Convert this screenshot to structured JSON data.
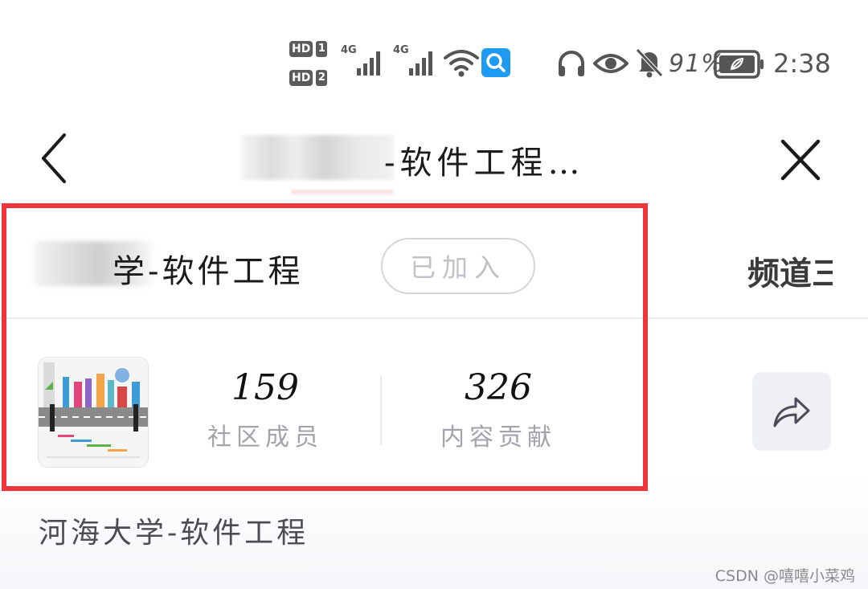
{
  "status_bar": {
    "sim1_label": "HD",
    "sim1_number": "1",
    "sim2_label": "HD",
    "sim2_number": "2",
    "network1": "4G",
    "network2": "4G",
    "battery_percent": "91%",
    "time": "2:38"
  },
  "title_bar": {
    "title": "-软件工程…"
  },
  "community": {
    "name": "学-软件工程",
    "joined_label": "已加入",
    "channel_label": "频道三",
    "stats": [
      {
        "value": "159",
        "label": "社区成员"
      },
      {
        "value": "326",
        "label": "内容贡献"
      }
    ],
    "description": "河海大学-软件工程"
  },
  "watermark": "CSDN @嘻嘻小菜鸡",
  "colors": {
    "highlight": "#f0343a",
    "joined_border": "#d4d5dc",
    "muted_text": "#a3a4ab",
    "share_bg": "#eef0f4"
  },
  "icons": {
    "back": "chevron-left-icon",
    "close": "close-icon",
    "share": "share-arrow-icon",
    "search_app": "search-app-icon",
    "headphones": "headphones-icon",
    "eye": "eye-icon",
    "mute": "bell-off-icon",
    "battery": "battery-icon",
    "wifi": "wifi-icon"
  }
}
